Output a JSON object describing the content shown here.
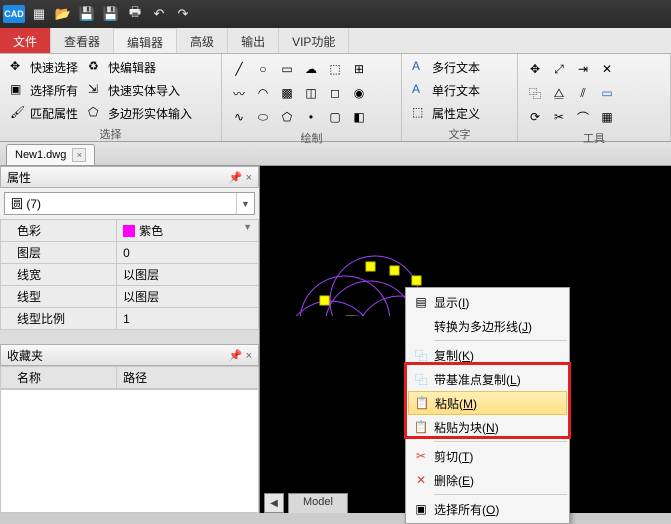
{
  "app": {
    "logo_text": "CAD"
  },
  "menu": {
    "file": "文件",
    "viewer": "查看器",
    "editor": "编辑器",
    "advanced": "高级",
    "output": "输出",
    "vip": "VIP功能"
  },
  "ribbon": {
    "select": {
      "quick_select": "快速选择",
      "quick_edit": "快编辑器",
      "select_all": "选择所有",
      "solid_import": "快速实体导入",
      "match_props": "匹配属性",
      "polygon_solid_input": "多边形实体输入",
      "label": "选择"
    },
    "draw_label": "绘制",
    "text": {
      "mtext": "多行文本",
      "stext": "单行文本",
      "attdef": "属性定义",
      "label": "文字"
    },
    "tools_label": "工具"
  },
  "tabs": {
    "file_tab": "New1.dwg"
  },
  "panes": {
    "props_title": "属性",
    "fav_title": "收藏夹"
  },
  "props": {
    "select_value": "圆 (7)",
    "rows": {
      "color": "色彩",
      "color_val": "紫色",
      "layer": "图层",
      "layer_val": "0",
      "lineweight": "线宽",
      "lineweight_val": "以图层",
      "linetype": "线型",
      "linetype_val": "以图层",
      "ltscale": "线型比例",
      "ltscale_val": "1"
    }
  },
  "fav": {
    "name_col": "名称",
    "path_col": "路径"
  },
  "canvas": {
    "model_tab": "Model"
  },
  "ctx": {
    "display": "显示",
    "display_k": "I",
    "to_polyline": "转换为多边形线",
    "to_polyline_k": "J",
    "copy": "复制",
    "copy_k": "K",
    "copy_base": "带基准点复制",
    "copy_base_k": "L",
    "paste": "粘贴",
    "paste_k": "M",
    "paste_block": "粘贴为块",
    "paste_block_k": "N",
    "cut": "剪切",
    "cut_k": "T",
    "delete": "删除",
    "delete_k": "E",
    "select_all": "选择所有",
    "select_all_k": "O"
  },
  "colors": {
    "purple": "#ff00ff"
  }
}
